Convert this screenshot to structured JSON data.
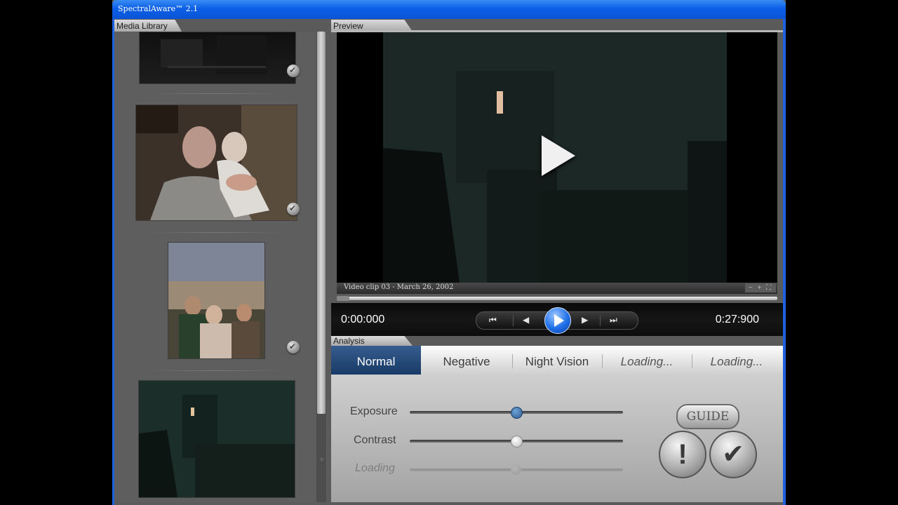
{
  "app": {
    "title": "SpectralAware™ 2.1"
  },
  "library": {
    "label": "Media Library",
    "items": [
      {
        "kind": "thumbnail",
        "selected": true
      },
      {
        "kind": "thumbnail",
        "selected": true
      },
      {
        "kind": "thumbnail",
        "selected": true
      },
      {
        "kind": "thumbnail",
        "selected": false
      }
    ]
  },
  "preview": {
    "label": "Preview",
    "caption": "Video clip 03 - March 26, 2002",
    "caption_icons": "− + ⛶",
    "progress": 0.0
  },
  "transport": {
    "current_time": "0:00:000",
    "total_time": "0:27:900",
    "icons": {
      "first": "⏮",
      "prev": "◀",
      "next": "▶",
      "last": "⏭"
    }
  },
  "analysis": {
    "label": "Analysis",
    "modes": [
      "Normal",
      "Negative",
      "Night Vision",
      "Loading...",
      "Loading..."
    ],
    "active_mode": "Normal",
    "sliders": [
      {
        "label": "Exposure",
        "value": 0.5,
        "enabled": true
      },
      {
        "label": "Contrast",
        "value": 0.5,
        "enabled": true
      },
      {
        "label": "Loading",
        "value": 0.5,
        "enabled": false
      }
    ],
    "guide_label": "GUIDE",
    "warn_label": "!",
    "ok_label": "✔"
  },
  "colors": {
    "titlebar": "#0b5fe6",
    "active_mode": "#1f4270",
    "exposure_knob": "#2b5b92"
  }
}
